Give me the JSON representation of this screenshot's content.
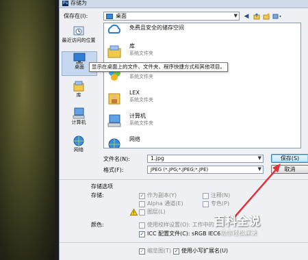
{
  "dialog": {
    "title": "存储为",
    "app_icon": "Ps"
  },
  "save_in": {
    "label": "保存在(I):",
    "value": "桌面"
  },
  "toolbar": {
    "icons": [
      "back-icon",
      "up-folder-icon",
      "new-folder-icon",
      "views-icon"
    ]
  },
  "places": [
    {
      "label": "最近访问的位置",
      "icon": "recent-places-icon"
    },
    {
      "label": "桌面",
      "icon": "desktop-icon",
      "selected": true
    },
    {
      "label": "库",
      "icon": "library-icon"
    },
    {
      "label": "计算机",
      "icon": "computer-icon"
    },
    {
      "label": "网络",
      "icon": "network-icon"
    }
  ],
  "files": [
    {
      "name": "免费且安全的储存空间",
      "subtitle": "",
      "icon": "cloud-icon"
    },
    {
      "name": "库",
      "subtitle": "系统文件夹",
      "icon": "library-icon"
    },
    {
      "name": "家庭组",
      "subtitle": "系统文件夹",
      "icon": "homegroup-icon"
    },
    {
      "name": "LEX",
      "subtitle": "系统文件夹",
      "icon": "user-folder-icon"
    },
    {
      "name": "计算机",
      "subtitle": "系统文件夹",
      "icon": "computer-icon"
    },
    {
      "name": "网络",
      "subtitle": "",
      "icon": "network-icon"
    }
  ],
  "tooltip": "显示在桌面上的文件、文件夹、程序快捷方式和其他项目。",
  "filename": {
    "label": "文件名(N):",
    "value": "1.jpg"
  },
  "format": {
    "label": "格式(F):",
    "value": "JPEG (*.JPG;*.JPEG;*.JPE)"
  },
  "buttons": {
    "save": "保存(S)",
    "cancel": "取消"
  },
  "options": {
    "section_title": "存储选项",
    "storage_label": "存储:",
    "as_copy": "作为副本(Y)",
    "alpha": "Alpha 通道(E)",
    "layers": "图层(L)",
    "notes": "注释(N)",
    "spot": "专色(P)"
  },
  "color": {
    "label": "颜色:",
    "use_proof": "使用校样设置(O):  工作中的",
    "icc": "ICC 配置文件(C):  sRGB IEC6"
  },
  "thumbnail": "缩览图(T)",
  "lowercase_ext": "使用小写扩展名(U)",
  "watermark": {
    "title": "百科全说",
    "subtitle": "助你轻松解决"
  },
  "colors": {
    "accent": "#3c7fb1",
    "selection": "#c6d8ef",
    "arrow": "#e0303a"
  }
}
